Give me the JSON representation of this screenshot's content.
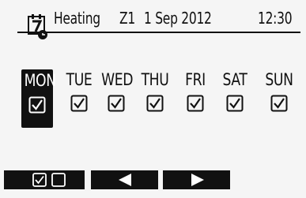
{
  "header": {
    "title": "Heating",
    "zone": "Z1",
    "date": "1 Sep  2012",
    "time": "12:30",
    "icon": "weekly-timer-icon"
  },
  "days": [
    {
      "label": "MON",
      "checked": true,
      "selected": true
    },
    {
      "label": "TUE",
      "checked": true,
      "selected": false
    },
    {
      "label": "WED",
      "checked": true,
      "selected": false
    },
    {
      "label": "THU",
      "checked": true,
      "selected": false
    },
    {
      "label": "FRI",
      "checked": true,
      "selected": false
    },
    {
      "label": "SAT",
      "checked": true,
      "selected": false
    },
    {
      "label": "SUN",
      "checked": true,
      "selected": false
    }
  ],
  "function_buttons": [
    {
      "name": "toggle-check",
      "icons": [
        "checked-box-icon",
        "empty-box-icon"
      ]
    },
    {
      "name": "left",
      "icons": [
        "left-arrow-icon"
      ]
    },
    {
      "name": "right",
      "icons": [
        "right-arrow-icon"
      ]
    }
  ]
}
